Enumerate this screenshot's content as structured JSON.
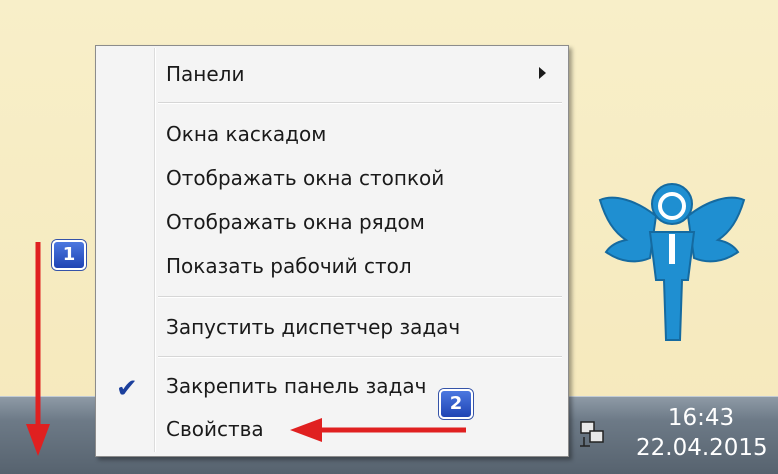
{
  "context_menu": {
    "items": [
      {
        "label": "Панели",
        "has_submenu": true
      },
      {
        "label": "Окна каскадом"
      },
      {
        "label": "Отображать окна стопкой"
      },
      {
        "label": "Отображать окна рядом"
      },
      {
        "label": "Показать рабочий стол"
      },
      {
        "label": "Запустить диспетчер задач"
      },
      {
        "label": "Закрепить панель задач",
        "checked": true
      },
      {
        "label": "Свойства"
      }
    ]
  },
  "taskbar": {
    "time": "16:43",
    "date": "22.04.2015",
    "tray_icon": "network-icon"
  },
  "annotations": {
    "badge1": "1",
    "badge2": "2",
    "arrow_color": "#e02020"
  },
  "desktop": {
    "logo_icon": "angel-logo-icon",
    "logo_color": "#1f8fd1",
    "background_color": "#f7edc4"
  }
}
